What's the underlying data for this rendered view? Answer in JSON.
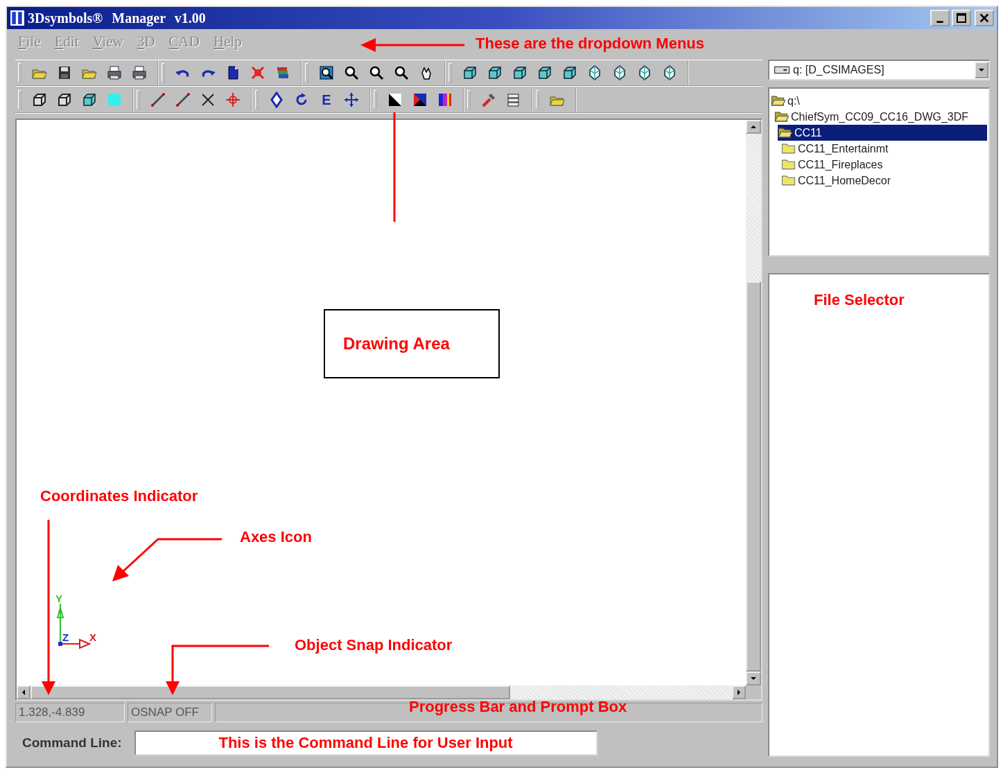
{
  "window": {
    "title": "3Dsymbols® Manager v1.00"
  },
  "menu": [
    {
      "label": "File",
      "disabled": true
    },
    {
      "label": "Edit",
      "disabled": true
    },
    {
      "label": "View",
      "disabled": true
    },
    {
      "label": "3D",
      "disabled": true
    },
    {
      "label": "CAD",
      "disabled": true
    },
    {
      "label": "Help",
      "disabled": true
    }
  ],
  "toolbar": {
    "text_button": "E"
  },
  "drive_select": {
    "value": "q: [D_CSIMAGES]"
  },
  "folder_tree": [
    {
      "label": "q:\\",
      "expanded": true,
      "selected": false,
      "children": [
        {
          "label": "ChiefSym_CC09_CC16_DWG_3DF",
          "expanded": true,
          "selected": false,
          "children": [
            {
              "label": "CC11",
              "expanded": true,
              "selected": true,
              "children": [
                {
                  "label": "CC11_Entertainmt",
                  "expanded": false,
                  "selected": false
                },
                {
                  "label": "CC11_Fireplaces",
                  "expanded": false,
                  "selected": false
                },
                {
                  "label": "CC11_HomeDecor",
                  "expanded": false,
                  "selected": false
                }
              ]
            }
          ]
        }
      ]
    }
  ],
  "axes_icon": {
    "labels": [
      "Y",
      "Z",
      "X"
    ]
  },
  "status_bar": {
    "coordinates": "1.328,-4.839",
    "osnap": "OSNAP OFF"
  },
  "command_line": {
    "label": "Command Line:",
    "value": "This is the Command Line for User Input"
  },
  "annotations": [
    {
      "text": "These are the dropdown Menus",
      "kind": "plain"
    },
    {
      "text": "Drawing Area",
      "kind": "boxed"
    },
    {
      "text": "File Selector",
      "kind": "plain"
    },
    {
      "text": "Coordinates Indicator",
      "kind": "plain"
    },
    {
      "text": "Axes Icon",
      "kind": "plain"
    },
    {
      "text": "Object Snap Indicator",
      "kind": "plain"
    },
    {
      "text": "Progress Bar and Prompt Box",
      "kind": "plain"
    }
  ]
}
